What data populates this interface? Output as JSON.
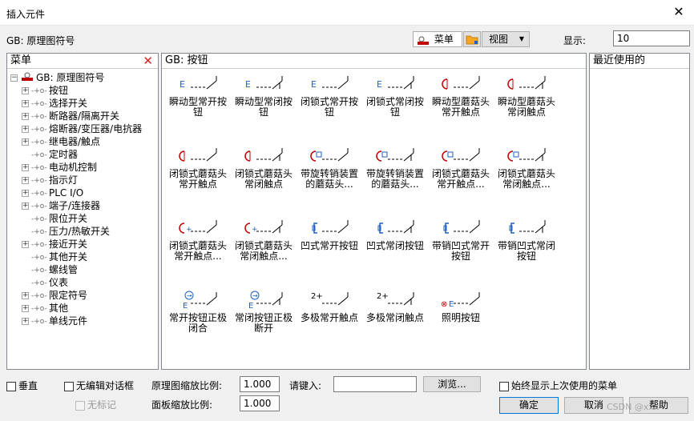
{
  "window": {
    "title": "插入元件"
  },
  "top": {
    "standard_label": "GB: 原理图符号",
    "menu_button": "菜单",
    "view_button": "视图",
    "display_label": "显示:",
    "display_value": "10"
  },
  "left_panel": {
    "header": "菜单",
    "root": "GB: 原理图符号",
    "items": [
      {
        "label": "按钮",
        "expandable": true
      },
      {
        "label": "选择开关",
        "expandable": true
      },
      {
        "label": "断路器/隔离开关",
        "expandable": true
      },
      {
        "label": "熔断器/变压器/电抗器",
        "expandable": true
      },
      {
        "label": "继电器/触点",
        "expandable": true
      },
      {
        "label": "定时器",
        "expandable": false
      },
      {
        "label": "电动机控制",
        "expandable": true
      },
      {
        "label": "指示灯",
        "expandable": true
      },
      {
        "label": "PLC I/O",
        "expandable": true
      },
      {
        "label": "端子/连接器",
        "expandable": true
      },
      {
        "label": "限位开关",
        "expandable": false
      },
      {
        "label": "压力/热敏开关",
        "expandable": false
      },
      {
        "label": "接近开关",
        "expandable": true
      },
      {
        "label": "其他开关",
        "expandable": false
      },
      {
        "label": "螺线管",
        "expandable": false
      },
      {
        "label": "仪表",
        "expandable": false
      },
      {
        "label": "限定符号",
        "expandable": true
      },
      {
        "label": "其他",
        "expandable": true
      },
      {
        "label": "单线元件",
        "expandable": true
      }
    ]
  },
  "center_panel": {
    "header": "GB: 按钮",
    "symbols": [
      {
        "l1": "瞬动型常开按",
        "l2": "钮",
        "l3": ""
      },
      {
        "l1": "瞬动型常闭按",
        "l2": "钮",
        "l3": ""
      },
      {
        "l1": "闭锁式常开按",
        "l2": "钮",
        "l3": ""
      },
      {
        "l1": "闭锁式常闭按",
        "l2": "钮",
        "l3": ""
      },
      {
        "l1": "瞬动型蘑菇头",
        "l2": "常开触点",
        "l3": ""
      },
      {
        "l1": "瞬动型蘑菇头",
        "l2": "常闭触点",
        "l3": ""
      },
      {
        "l1": "闭锁式蘑菇头",
        "l2": "常开触点",
        "l3": ""
      },
      {
        "l1": "闭锁式蘑菇头",
        "l2": "常闭触点",
        "l3": ""
      },
      {
        "l1": "带旋转销装置",
        "l2": "的蘑菇头...",
        "l3": ""
      },
      {
        "l1": "带旋转销装置",
        "l2": "的蘑菇头...",
        "l3": ""
      },
      {
        "l1": "闭锁式蘑菇头",
        "l2": "常开触点...",
        "l3": ""
      },
      {
        "l1": "闭锁式蘑菇头",
        "l2": "常闭触点...",
        "l3": ""
      },
      {
        "l1": "闭锁式蘑菇头",
        "l2": "常开触点...",
        "l3": ""
      },
      {
        "l1": "闭锁式蘑菇头",
        "l2": "常闭触点...",
        "l3": ""
      },
      {
        "l1": "凹式常开按钮",
        "l2": "",
        "l3": ""
      },
      {
        "l1": "凹式常闭按钮",
        "l2": "",
        "l3": ""
      },
      {
        "l1": "带销凹式常开",
        "l2": "按钮",
        "l3": ""
      },
      {
        "l1": "带销凹式常闭",
        "l2": "按钮",
        "l3": ""
      },
      {
        "l1": "常开按钮正极",
        "l2": "闭合",
        "l3": ""
      },
      {
        "l1": "常闭按钮正极",
        "l2": "断开",
        "l3": ""
      },
      {
        "l1": "多极常开触点",
        "l2": "",
        "l3": ""
      },
      {
        "l1": "多极常闭触点",
        "l2": "",
        "l3": ""
      },
      {
        "l1": "照明按钮",
        "l2": "",
        "l3": ""
      }
    ]
  },
  "right_panel": {
    "header": "最近使用的"
  },
  "bottom": {
    "vertical_label": "垂直",
    "no_edit_dialog_label": "无编辑对话框",
    "no_tag_label": "无标记",
    "schematic_scale_label": "原理图缩放比例:",
    "schematic_scale_value": "1.000",
    "panel_scale_label": "面板缩放比例:",
    "panel_scale_value": "1.000",
    "key_in_label": "请键入:",
    "key_in_value": "",
    "browse_button": "浏览...",
    "always_show_label": "始终显示上次使用的菜单",
    "ok_button": "确定",
    "cancel_button": "取消",
    "help_button": "帮助"
  },
  "watermark": "CSDN @xxx",
  "colors": {
    "accent_red": "#c00000",
    "accent_blue": "#1f5fbf",
    "button_bg": "#e1e1e1",
    "ok_border": "#0078d7"
  }
}
